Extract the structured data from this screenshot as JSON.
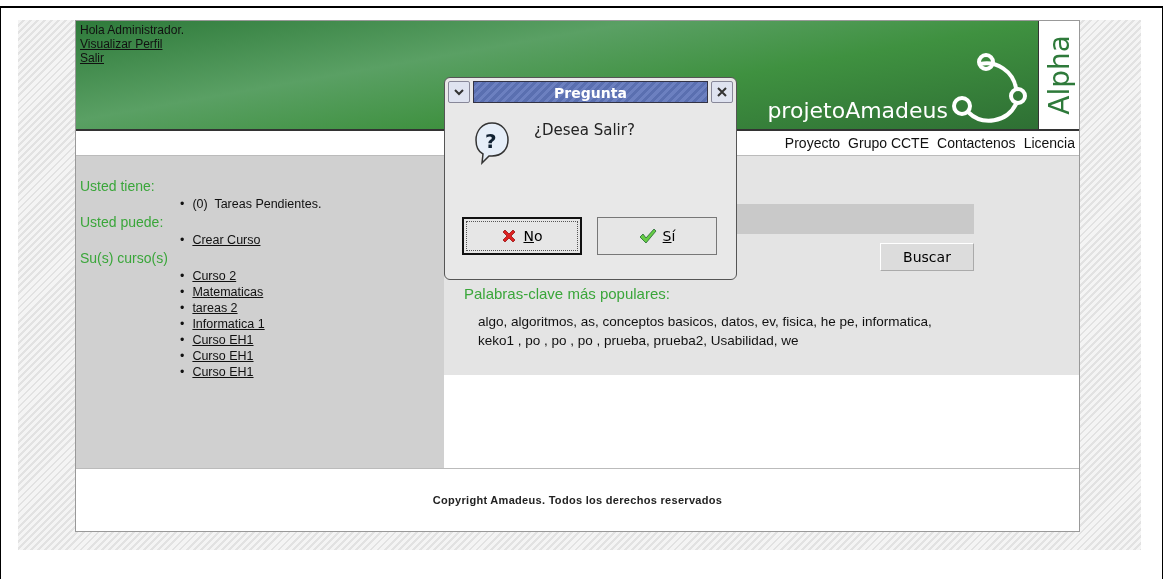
{
  "header": {
    "greeting": "Hola Administrador.",
    "links": [
      "Visualizar Perfil",
      "Salir"
    ],
    "logo_text": "projetoAmadeus",
    "badge": "Alpha"
  },
  "nav": [
    "Proyecto",
    "Grupo CCTE",
    "Contactenos",
    "Licencia"
  ],
  "sidebar": {
    "sections": [
      {
        "heading": "Usted tiene:",
        "marker": "•",
        "items": [
          {
            "kind": "text",
            "label": "(0)  Tareas Pendientes."
          }
        ]
      },
      {
        "heading": "Usted puede:",
        "marker": "•",
        "items": [
          {
            "kind": "link",
            "label": "Crear Curso"
          }
        ]
      },
      {
        "heading": "Su(s) curso(s)",
        "marker": "•",
        "items": [
          {
            "kind": "link",
            "label": "Curso 2"
          },
          {
            "kind": "link",
            "label": "Matematicas"
          },
          {
            "kind": "link",
            "label": "tareas 2"
          },
          {
            "kind": "link",
            "label": "Informatica 1"
          },
          {
            "kind": "link",
            "label": "Curso EH1"
          },
          {
            "kind": "link",
            "label": "Curso EH1"
          },
          {
            "kind": "link",
            "label": "Curso EH1"
          }
        ]
      }
    ]
  },
  "search": {
    "button": "Buscar"
  },
  "keywords": {
    "heading": "Palabras-clave más populares:",
    "text": "algo, algoritmos, as, conceptos basicos, datos, ev, fisica, he pe, informatica, keko1 , po , po , po , prueba, prueba2, Usabilidad, we"
  },
  "footer": "Copyright Amadeus. Todos los derechos reservados",
  "dialog": {
    "title": "Pregunta",
    "message": "¿Desea Salir?",
    "icon_glyph": "?",
    "buttons": [
      {
        "kind": "no",
        "label": "No",
        "focused": true
      },
      {
        "kind": "yes",
        "label": "Sí",
        "focused": false
      }
    ]
  }
}
